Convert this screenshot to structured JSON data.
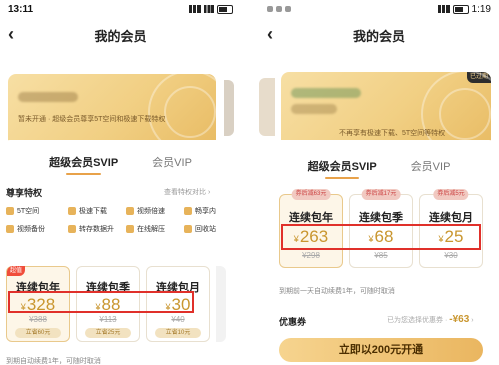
{
  "left": {
    "status_time": "13:11",
    "title": "我的会员",
    "card_text": "暂未开通 · 超级会员尊享5T空间和极速下载特权",
    "tabs": [
      "超级会员SVIP",
      "会员VIP"
    ],
    "privileges_title": "尊享特权",
    "privileges_link": "查看特权对比 ›",
    "privileges": [
      "5T空间",
      "极速下载",
      "视频倍速",
      "畅享内",
      "视频备份",
      "转存数据升",
      "在线解压",
      "回收站"
    ],
    "plans": [
      {
        "name": "连续包年",
        "yen": "¥",
        "price": "328",
        "orig": "¥388",
        "badge": "超值",
        "chip": "立省60元"
      },
      {
        "name": "连续包季",
        "yen": "¥",
        "price": "88",
        "orig": "¥113",
        "chip": "立省25元"
      },
      {
        "name": "连续包月",
        "yen": "¥",
        "price": "30",
        "orig": "¥40",
        "chip": "立省10元"
      }
    ],
    "bottom_note": "到期自动续费1年，可随时取消"
  },
  "right": {
    "status_time": "1:19",
    "title": "我的会员",
    "card_text": "不再享有极速下载、5T空间等特权",
    "card_tag": "已过期",
    "tabs": [
      "超级会员SVIP",
      "会员VIP"
    ],
    "plans": [
      {
        "name": "连续包年",
        "yen": "¥",
        "price": "263",
        "orig": "¥298",
        "badge": "券后减63元"
      },
      {
        "name": "连续包季",
        "yen": "¥",
        "price": "68",
        "orig": "¥85",
        "badge": "券后减17元"
      },
      {
        "name": "连续包月",
        "yen": "¥",
        "price": "25",
        "orig": "¥30",
        "badge": "券后减5元"
      }
    ],
    "renew_note": "到期前一天自动续费1年，可随时取消",
    "coupon_label": "优惠券",
    "coupon_hint": "已为您选择优惠券 · ",
    "coupon_value": "-¥63",
    "coupon_arrow": "›",
    "cta": "立即以200元开通"
  },
  "colors": {
    "accent": "#c9962f",
    "highlight": "#e0302a",
    "gold": "#eab660"
  },
  "icons": {
    "back": "‹"
  }
}
